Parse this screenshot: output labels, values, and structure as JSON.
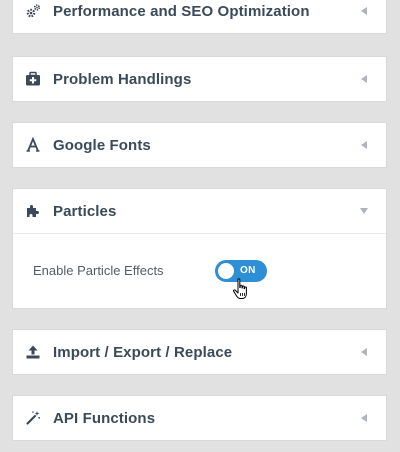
{
  "colors": {
    "background": "#e1e1e1",
    "panel": "#ffffff",
    "title_text": "#3b4a5a",
    "toggle_on": "#2d8fd6",
    "chevron": "#aeb4ba"
  },
  "panels": [
    {
      "title": "Performance and SEO Optimization",
      "icon": "gears-icon",
      "expanded": false
    },
    {
      "title": "Problem Handlings",
      "icon": "first-aid-kit-icon",
      "expanded": false
    },
    {
      "title": "Google Fonts",
      "icon": "font-letter-a-icon",
      "expanded": false
    },
    {
      "title": "Particles",
      "icon": "puzzle-icon",
      "expanded": true
    },
    {
      "title": "Import / Export / Replace",
      "icon": "upload-icon",
      "expanded": false
    },
    {
      "title": "API Functions",
      "icon": "magic-wand-icon",
      "expanded": false
    }
  ],
  "particles": {
    "option_label": "Enable Particle Effects",
    "toggle_state": "ON",
    "enabled": true
  },
  "cursor": "hand-pointer-icon"
}
